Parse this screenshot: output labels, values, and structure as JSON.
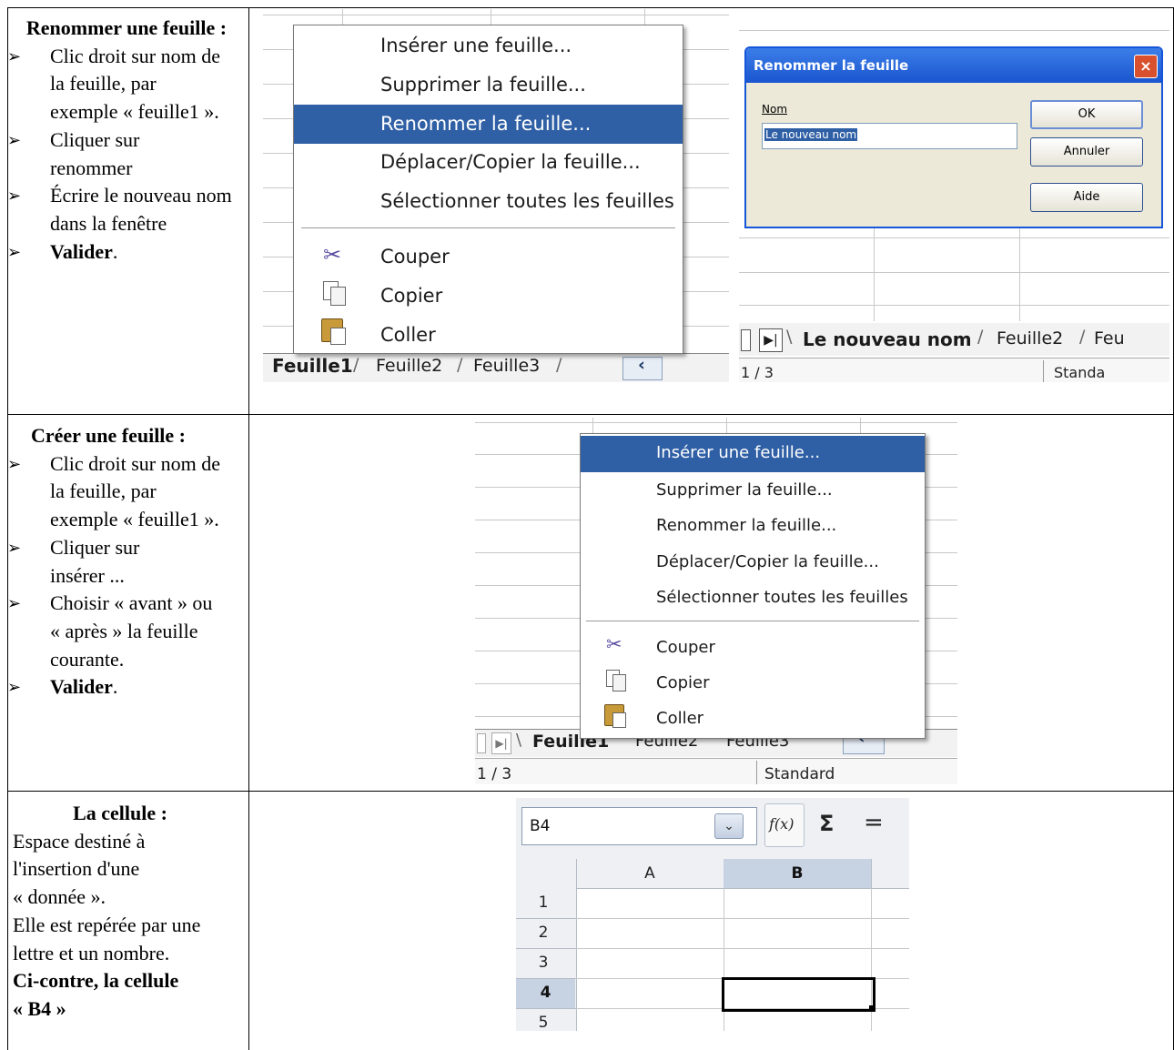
{
  "row1": {
    "title": "Renommer une feuille :",
    "steps": [
      {
        "text": "Clic droit sur nom de la feuille, par exemple « feuille1 »."
      },
      {
        "text": "Cliquer sur renommer"
      },
      {
        "text": "Écrire le nouveau nom dans la fenêtre"
      },
      {
        "bold": "Valider",
        "suffix": "."
      }
    ],
    "menu": {
      "items": [
        "Insérer une feuille...",
        "Supprimer la feuille...",
        "Renommer la feuille...",
        "Déplacer/Copier la feuille...",
        "Sélectionner toutes les feuilles"
      ],
      "highlighted_index": 2,
      "edit_items": [
        {
          "icon": "scissors-icon",
          "label": "Couper"
        },
        {
          "icon": "copy-icon",
          "label": "Copier"
        },
        {
          "icon": "paste-icon",
          "label": "Coller"
        }
      ]
    },
    "tabs": [
      "Feuille1",
      "Feuille2",
      "Feuille3"
    ],
    "dialog": {
      "title": "Renommer la feuille",
      "field_label": "Nom",
      "field_value": "Le nouveau nom",
      "buttons": [
        "OK",
        "Annuler",
        "Aide"
      ]
    },
    "renamed_tabs": [
      "Le nouveau nom",
      "Feuille2",
      "Feu"
    ],
    "status_fragment": "1 / 3",
    "status_right_fragment": "Standa"
  },
  "row2": {
    "title": "Créer une feuille :",
    "steps": [
      {
        "text": "Clic droit sur nom de la feuille, par exemple « feuille1 »."
      },
      {
        "text": "Cliquer sur insérer ..."
      },
      {
        "text": "Choisir « avant » ou « après » la feuille courante."
      },
      {
        "bold": "Valider",
        "suffix": "."
      }
    ],
    "menu": {
      "items": [
        "Insérer une feuille...",
        "Supprimer la feuille...",
        "Renommer la feuille...",
        "Déplacer/Copier la feuille...",
        "Sélectionner toutes les feuilles"
      ],
      "highlighted_index": 0,
      "edit_items": [
        {
          "icon": "scissors-icon",
          "label": "Couper"
        },
        {
          "icon": "copy-icon",
          "label": "Copier"
        },
        {
          "icon": "paste-icon",
          "label": "Coller"
        }
      ]
    },
    "tabs": [
      "Feuille1",
      "Feuille2",
      "Feuille3"
    ],
    "status_left": "1 / 3",
    "status_right": "Standard"
  },
  "row3": {
    "title": "La cellule :",
    "lines": [
      "Espace destiné à",
      "l'insertion d'une",
      "« donnée ».",
      "Elle est repérée par une",
      "lettre et un nombre."
    ],
    "bold_lines": [
      "Ci-contre, la cellule",
      "« B4 »"
    ],
    "namebox": {
      "value": "B4",
      "fx_label": "f(x)",
      "sigma": "Σ",
      "equals": "=",
      "columns": [
        "A",
        "B"
      ],
      "rows": [
        "1",
        "2",
        "3",
        "4",
        "5"
      ],
      "selected_row": "4",
      "selected_col": "B"
    }
  }
}
